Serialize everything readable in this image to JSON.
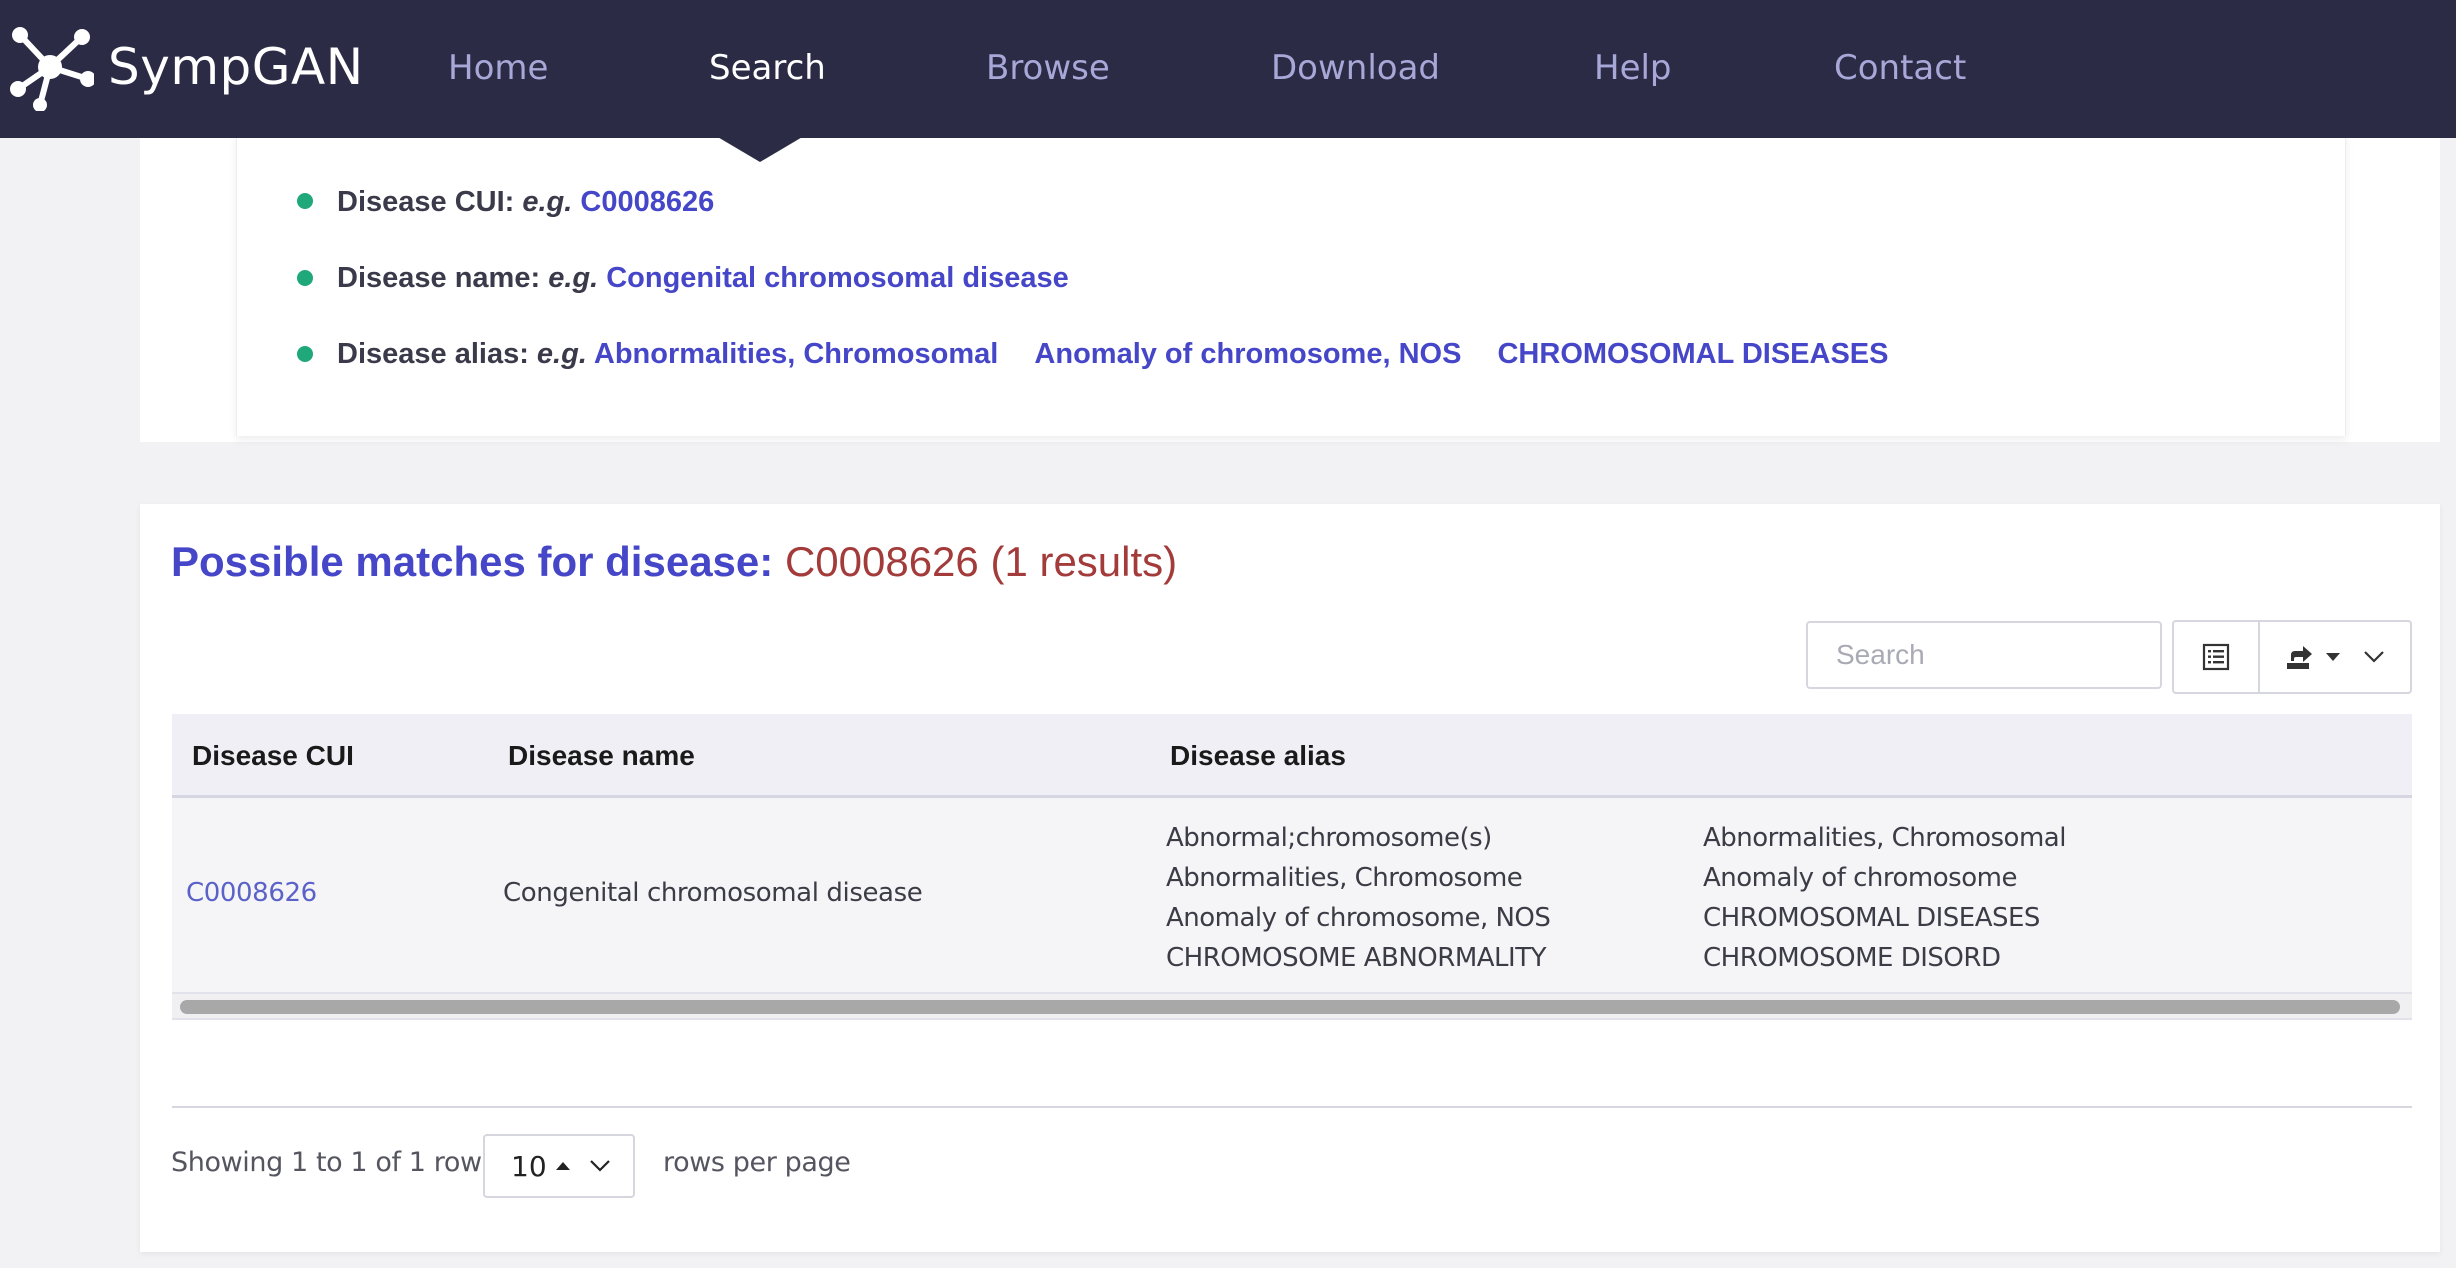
{
  "nav": {
    "brand": "SympGAN",
    "items": [
      {
        "label": "Home",
        "active": false
      },
      {
        "label": "Search",
        "active": true
      },
      {
        "label": "Browse",
        "active": false
      },
      {
        "label": "Download",
        "active": false
      },
      {
        "label": "Help",
        "active": false
      },
      {
        "label": "Contact",
        "active": false
      }
    ]
  },
  "examples": {
    "eg": "e.g.",
    "cui": {
      "label": "Disease CUI:",
      "links": [
        "C0008626"
      ]
    },
    "name": {
      "label": "Disease name:",
      "links": [
        "Congenital chromosomal disease"
      ]
    },
    "alias": {
      "label": "Disease alias:",
      "links": [
        "Abnormalities, Chromosomal",
        "Anomaly of chromosome, NOS",
        "CHROMOSOMAL DISEASES"
      ]
    }
  },
  "results": {
    "title_label": "Possible matches for disease:",
    "query": "C0008626",
    "count": "(1 results)",
    "search_placeholder": "Search",
    "columns": [
      "Disease CUI",
      "Disease name",
      "Disease alias"
    ],
    "rows": [
      {
        "cui": "C0008626",
        "name": "Congenital chromosomal disease",
        "aliases_col1": [
          "Abnormal;chromosome(s)",
          "Abnormalities, Chromosome",
          "Anomaly of chromosome, NOS",
          "CHROMOSOME ABNORMALITY"
        ],
        "aliases_col2": [
          "Abnormalities, Chromosomal",
          "Anomaly of chromosome",
          "CHROMOSOMAL DISEASES",
          "CHROMOSOME DISORD"
        ]
      }
    ],
    "pagination": {
      "showing": "Showing 1 to 1 of 1 rows",
      "page_size": "10",
      "rows_per_page": "rows per page"
    }
  },
  "icons": {
    "brand": "network-logo-icon",
    "columns": "columns-list-icon",
    "export": "export-icon",
    "caret": "caret-down-icon",
    "chevron": "chevron-down-icon",
    "sort": "caret-up-icon"
  },
  "colors": {
    "navbar": "#2b2b45",
    "nav_active": "#ffffff",
    "nav_inactive": "#a8a8d8",
    "link": "#4646c8",
    "query": "#a33b3b",
    "timeline_dot": "#1fa87a"
  }
}
